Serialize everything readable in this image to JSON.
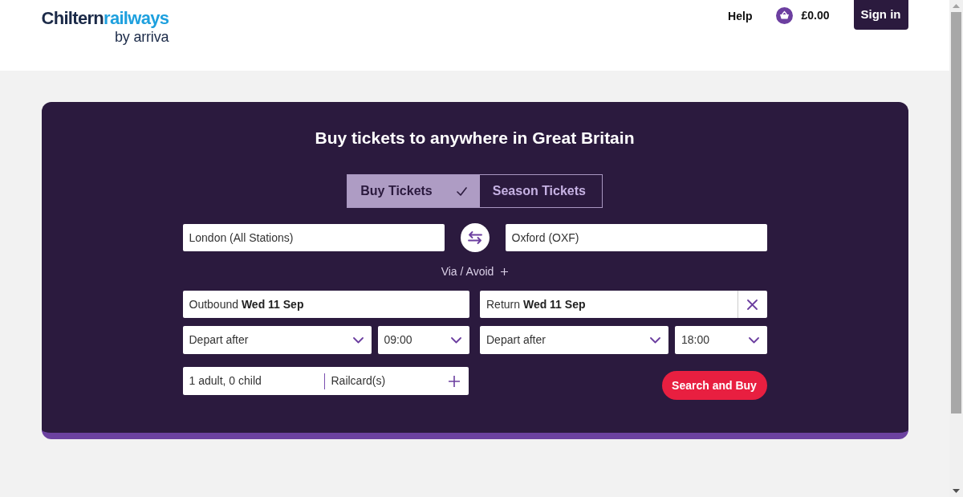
{
  "header": {
    "logo": {
      "wordmark": [
        "Chiltern",
        "railways"
      ],
      "tagline": "by arriva"
    },
    "nav": [
      {
        "kind": "link",
        "label": "Help"
      },
      {
        "kind": "basket",
        "label": "£0.00"
      },
      {
        "kind": "button",
        "label": "Sign in"
      }
    ]
  },
  "journey_planner": {
    "title": "Buy tickets to anywhere in Great Britain",
    "tabs": [
      {
        "label": "Buy Tickets",
        "selected": true
      },
      {
        "label": "Season Tickets",
        "selected": false
      }
    ],
    "from": {
      "value": "London (All Stations)"
    },
    "to": {
      "value": "Oxford (OXF)"
    },
    "via_avoid": "Via / Avoid",
    "outbound": {
      "value": "Outbound **Wed 11 Sep**",
      "mode": "Depart after",
      "time": "09:00"
    },
    "return": {
      "value": "Return **Wed 11 Sep**",
      "mode": "Depart after",
      "time": "18:00"
    },
    "passengers": "1 adult, 0 child",
    "railcards": "Railcard(s)",
    "search_button": "Search and Buy"
  }
}
